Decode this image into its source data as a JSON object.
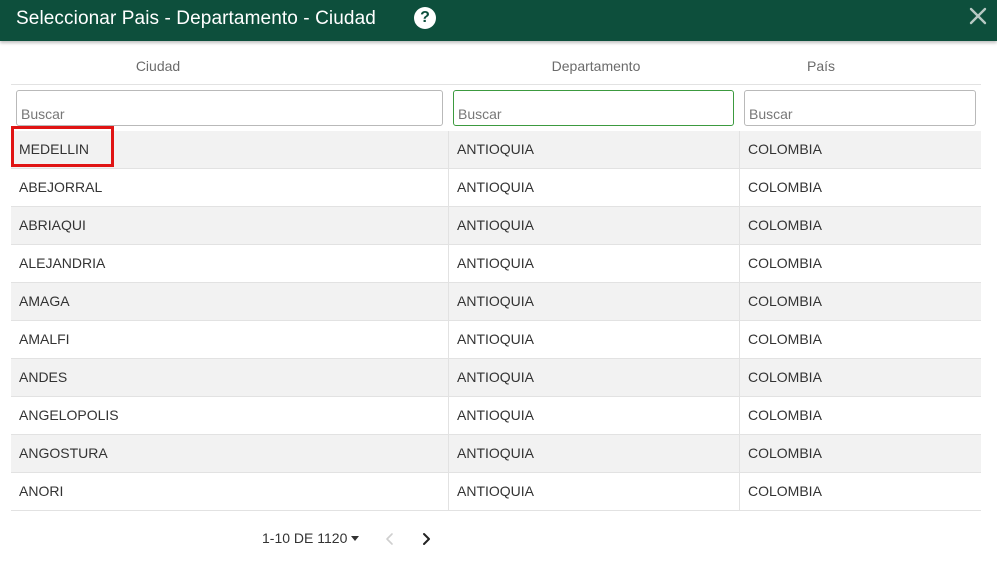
{
  "dialog": {
    "title": "Seleccionar Pais - Departamento - Ciudad",
    "help_icon": "question-circle-icon",
    "help_glyph": "?",
    "close_icon": "close-icon",
    "header_color": "#0d4f3c"
  },
  "table": {
    "columns": [
      "Ciudad",
      "Departamento",
      "País"
    ],
    "filters": [
      {
        "placeholder": "Buscar",
        "value": ""
      },
      {
        "placeholder": "Buscar",
        "value": "",
        "focused": true
      },
      {
        "placeholder": "Buscar",
        "value": ""
      }
    ],
    "rows": [
      [
        "MEDELLIN",
        "ANTIOQUIA",
        "COLOMBIA"
      ],
      [
        "ABEJORRAL",
        "ANTIOQUIA",
        "COLOMBIA"
      ],
      [
        "ABRIAQUI",
        "ANTIOQUIA",
        "COLOMBIA"
      ],
      [
        "ALEJANDRIA",
        "ANTIOQUIA",
        "COLOMBIA"
      ],
      [
        "AMAGA",
        "ANTIOQUIA",
        "COLOMBIA"
      ],
      [
        "AMALFI",
        "ANTIOQUIA",
        "COLOMBIA"
      ],
      [
        "ANDES",
        "ANTIOQUIA",
        "COLOMBIA"
      ],
      [
        "ANGELOPOLIS",
        "ANTIOQUIA",
        "COLOMBIA"
      ],
      [
        "ANGOSTURA",
        "ANTIOQUIA",
        "COLOMBIA"
      ],
      [
        "ANORI",
        "ANTIOQUIA",
        "COLOMBIA"
      ]
    ],
    "highlighted_row": 0,
    "highlight_color": "#e01414"
  },
  "pagination": {
    "range_label": "1-10 DE 1120",
    "prev_icon": "chevron-left-icon",
    "next_icon": "chevron-right-icon"
  }
}
